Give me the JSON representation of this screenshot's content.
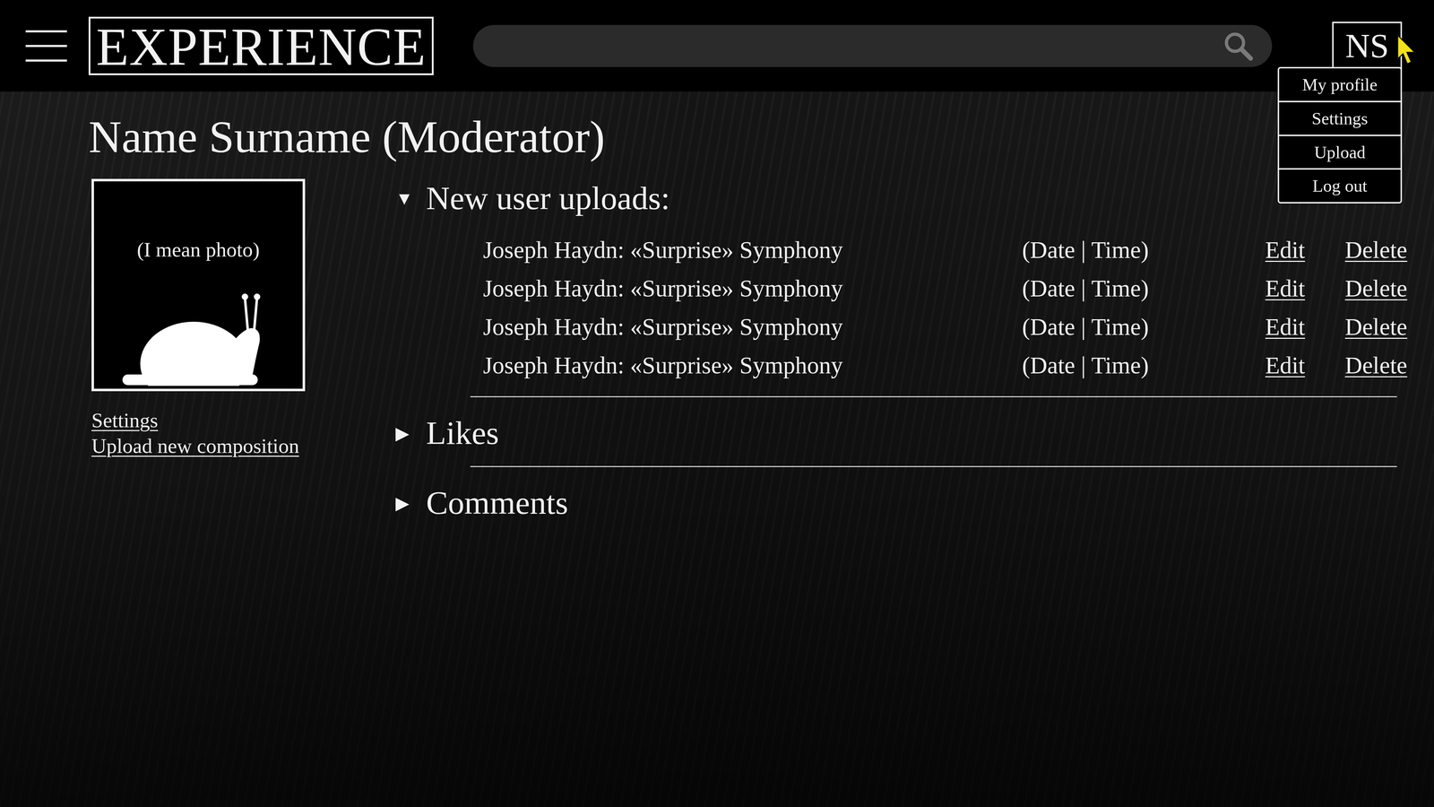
{
  "header": {
    "logo": "EXPERIENCE",
    "user_initials": "NS"
  },
  "user_menu": {
    "open": true,
    "items": [
      "My profile",
      "Settings",
      "Upload",
      "Log out"
    ]
  },
  "profile": {
    "title": "Name Surname (Moderator)",
    "photo_caption": "(I mean photo)",
    "links": [
      "Settings",
      "Upload new composition"
    ]
  },
  "sections": [
    {
      "arrow": "▼",
      "label": "New user uploads:",
      "expanded": true,
      "rows": [
        {
          "title": "Joseph Haydn: «Surprise» Symphony",
          "datetime": "(Date | Time)",
          "actions": [
            "Edit",
            "Delete"
          ]
        },
        {
          "title": "Joseph Haydn: «Surprise» Symphony",
          "datetime": "(Date | Time)",
          "actions": [
            "Edit",
            "Delete"
          ]
        },
        {
          "title": "Joseph Haydn: «Surprise» Symphony",
          "datetime": "(Date | Time)",
          "actions": [
            "Edit",
            "Delete"
          ]
        },
        {
          "title": "Joseph Haydn: «Surprise» Symphony",
          "datetime": "(Date | Time)",
          "actions": [
            "Edit",
            "Delete"
          ]
        }
      ]
    },
    {
      "arrow": "▶",
      "label": "Likes",
      "expanded": false,
      "rows": []
    },
    {
      "arrow": "▶",
      "label": "Comments",
      "expanded": false,
      "rows": []
    }
  ]
}
